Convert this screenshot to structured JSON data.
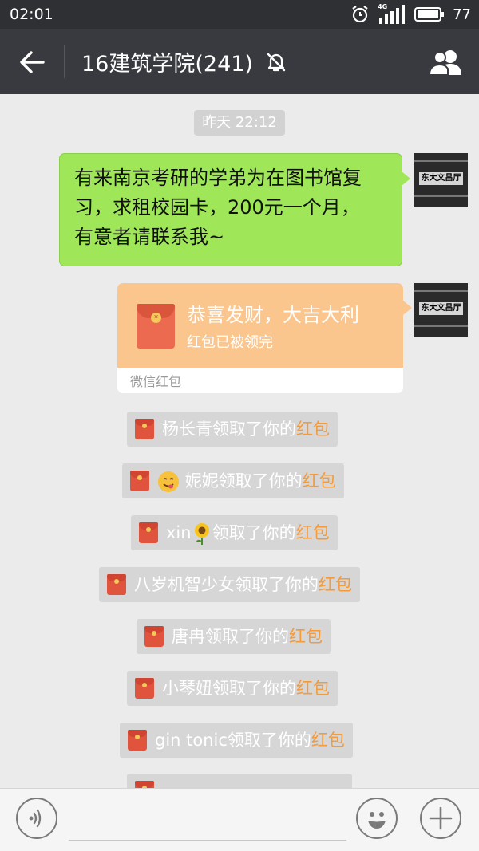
{
  "status_bar": {
    "time": "02:01",
    "network": "4G",
    "battery": "77",
    "icons": [
      "alarm-icon",
      "signal-icon",
      "battery-icon"
    ]
  },
  "header": {
    "title": "16建筑学院(241)",
    "icons": [
      "back-arrow-icon",
      "mute-bell-icon",
      "group-members-icon"
    ]
  },
  "chat": {
    "timestamp": "昨天 22:12",
    "messages": [
      {
        "type": "text",
        "text_lines": [
          "有来南京考研的学弟为在图书馆复",
          "习，求租校园卡，200元一个月，",
          "有意者请联系我~"
        ],
        "avatar_sign": "东大文昌厅"
      },
      {
        "type": "red_packet",
        "greeting": "恭喜发财，大吉大利",
        "status": "红包已被领完",
        "footer": "微信红包",
        "avatar_sign": "东大文昌厅"
      }
    ],
    "notices": [
      {
        "name": "杨长青",
        "emoji": "",
        "suffix": "领取了你的",
        "link": "红包"
      },
      {
        "name": "妮妮",
        "emoji": "yum-face",
        "suffix": "领取了你的",
        "link": "红包"
      },
      {
        "name": "xin",
        "emoji": "sunflower",
        "suffix": "领取了你的",
        "link": "红包"
      },
      {
        "name": "八岁机智少女",
        "emoji": "",
        "suffix": "领取了你的",
        "link": "红包"
      },
      {
        "name": "唐冉",
        "emoji": "",
        "suffix": "领取了你的",
        "link": "红包"
      },
      {
        "name": "小琴妞",
        "emoji": "",
        "suffix": "领取了你的",
        "link": "红包"
      },
      {
        "name": "gin tonic",
        "emoji": "",
        "suffix": "领取了你的",
        "link": "红包"
      }
    ]
  },
  "input_bar": {
    "value": "",
    "icons": [
      "voice-icon",
      "emoji-icon",
      "plus-icon"
    ]
  },
  "colors": {
    "nav": "#393a3f",
    "bubble": "#9fe658",
    "red_packet": "#fac68d",
    "highlight": "#f39a3b",
    "background": "#ebebeb"
  }
}
